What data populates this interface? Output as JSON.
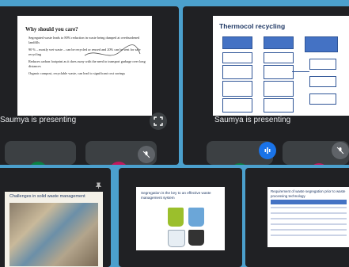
{
  "tiles": [
    {
      "presenter": "Saumya is presenting",
      "slide_title": "Why should you care?",
      "bullets": [
        "Segregated waste leads to 80% reduction in waste being dumped at overburdened landfills",
        "90 % – mostly wet waste – can be recycled or reused and 20% can be sent for safe recycling",
        "Reduces carbon footprint as it does away with the need to transport garbage over long distances",
        "Organic compost, recyclable waste, can lead to significant cost savings"
      ]
    },
    {
      "presenter": "Saumya is presenting",
      "slide_title": "Thermocol recycling"
    },
    {
      "slide_title": "Challenges in solid waste management"
    },
    {
      "slide_title": "Segregation is the key to an effective waste management system"
    },
    {
      "slide_title": "Requirement of waste segregation prior to waste processing technology"
    }
  ],
  "colors": {
    "background": "#4ba0cd",
    "tile": "#202124",
    "accent_blue": "#1a73e8",
    "diagram_blue": "#4472c4"
  },
  "icons": [
    "fullscreen-icon",
    "mic-off-icon",
    "speaking-icon",
    "pin-icon"
  ]
}
